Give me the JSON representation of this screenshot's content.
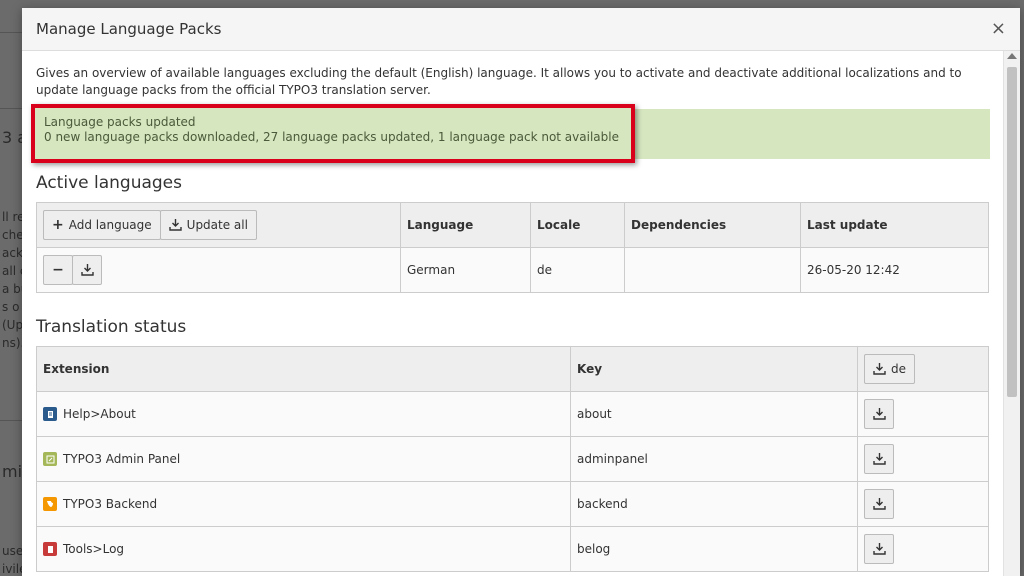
{
  "modal": {
    "title": "Manage Language Packs",
    "close_symbol": "×"
  },
  "intro": "Gives an overview of available languages excluding the default (English) language. It allows you to activate and deactivate additional localizations and to update language packs from the official TYPO3 translation server.",
  "alert": {
    "title": "Language packs updated",
    "message": "0 new language packs downloaded, 27 language packs updated, 1 language pack not available"
  },
  "active_languages": {
    "heading": "Active languages",
    "add_button": "Add language",
    "update_all_button": "Update all",
    "columns": {
      "language": "Language",
      "locale": "Locale",
      "dependencies": "Dependencies",
      "last_update": "Last update"
    },
    "rows": [
      {
        "language": "German",
        "locale": "de",
        "dependencies": "",
        "last_update": "26-05-20 12:42"
      }
    ]
  },
  "translation_status": {
    "heading": "Translation status",
    "columns": {
      "extension": "Extension",
      "key": "Key",
      "lang": "de"
    },
    "rows": [
      {
        "extension": "Help>About",
        "key": "about",
        "icon": "help-about-icon",
        "color": "#2b5a8c"
      },
      {
        "extension": "TYPO3 Admin Panel",
        "key": "adminpanel",
        "icon": "admin-panel-icon",
        "color": "#a4b85a"
      },
      {
        "extension": "TYPO3 Backend",
        "key": "backend",
        "icon": "typo3-icon",
        "color": "#f49700"
      },
      {
        "extension": "Tools>Log",
        "key": "belog",
        "icon": "tools-log-icon",
        "color": "#c73b3b"
      }
    ]
  },
  "background": {
    "fragments": [
      "3 a",
      "ll re",
      "che",
      "ack",
      "all c",
      "a bu",
      "s o",
      "(Up",
      "ns).",
      "mini",
      "use",
      "ivile"
    ]
  }
}
